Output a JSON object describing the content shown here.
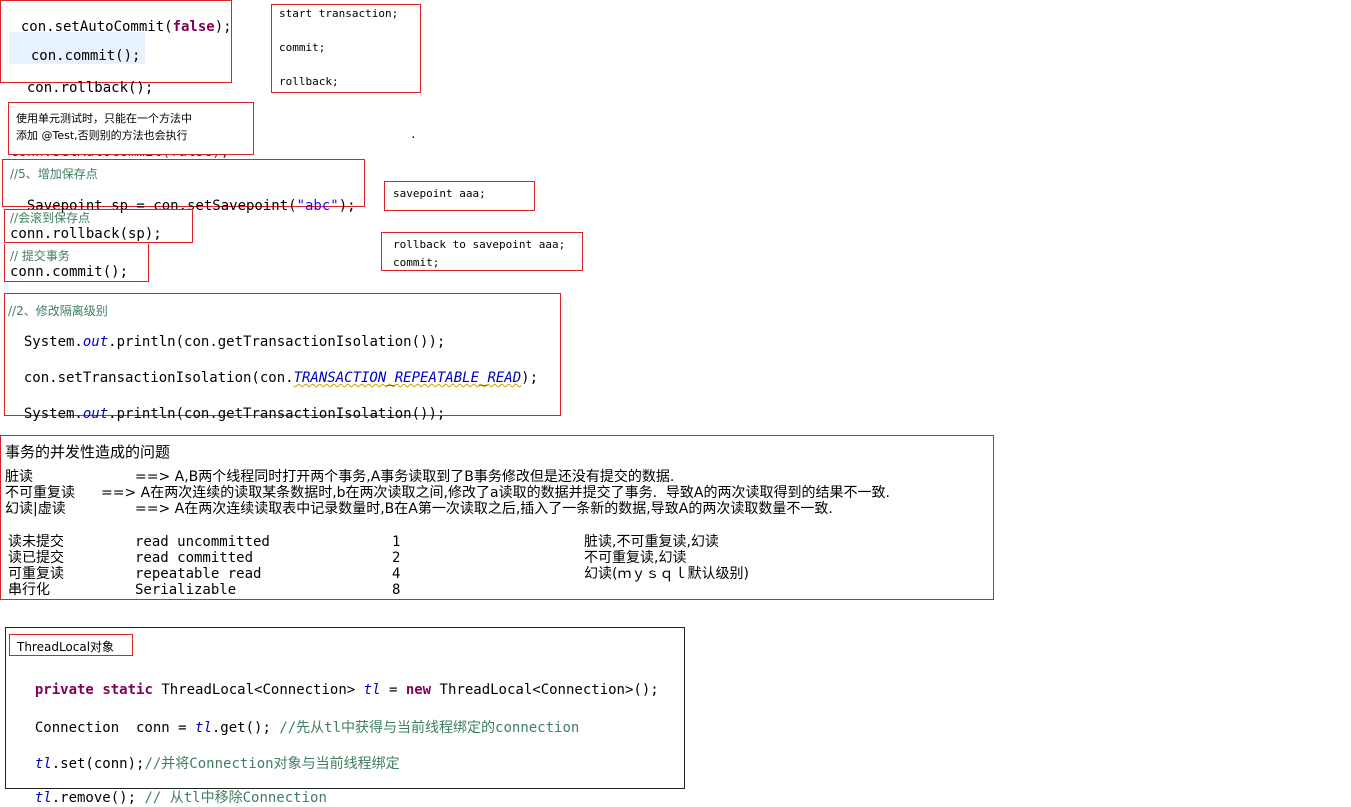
{
  "commit_block": {
    "set_autocommit_prefix": "con.setAutoCommit(",
    "false_kw": "false",
    "set_autocommit_suffix": ");",
    "commit": "con.commit();",
    "rollback": "con.rollback();"
  },
  "sql_block": {
    "start": "start transaction;",
    "commit": "commit;",
    "rollback": "rollback;"
  },
  "note": {
    "line1": "使用单元测试时，只能在一个方法中",
    "line2": "添加 @Test,否则别的方法也会执行",
    "dot": ".",
    "hidden_line": "conn.setAutoCommit(false);"
  },
  "savepoint_block": {
    "comment": "//5、增加保存点",
    "code_prefix": "Savepoint sp = con.setSavepoint(",
    "code_string": "\"abc\"",
    "code_suffix": ");"
  },
  "savepoint_sql": "savepoint aaa;",
  "rollback_block": {
    "comment": "//会滚到保存点",
    "code": "conn.rollback(sp);"
  },
  "commit_block2": {
    "comment": "// 提交事务",
    "code": "conn.commit();"
  },
  "rollback_sql": {
    "line1": "rollback to savepoint aaa;",
    "line2": "commit;"
  },
  "isolation_block": {
    "comment": "//2、修改隔离级别",
    "line1_prefix": "System.",
    "line1_out": "out",
    "line1_suffix": ".println(con.getTransactionIsolation());",
    "line2_prefix": "con.setTransactionIsolation(con.",
    "line2_const": "TRANSACTION_REPEATABLE_READ",
    "line2_suffix": ");",
    "line3_prefix": "System.",
    "line3_out": "out",
    "line3_suffix": ".println(con.getTransactionIsolation());"
  },
  "concurrency": {
    "title": "事务的并发性造成的问题",
    "problems": [
      {
        "name": "脏读",
        "desc": "==> A,B两个线程同时打开两个事务,A事务读取到了B事务修改但是还没有提交的数据."
      },
      {
        "name": "不可重复读",
        "desc": "==> A在两次连续的读取某条数据时,b在两次读取之间,修改了a读取的数据并提交了事务.  导致A的两次读取得到的结果不一致."
      },
      {
        "name": "幻读|虚读",
        "desc": "==> A在两次连续读取表中记录数量时,B在A第一次读取之后,插入了一条新的数据,导致A的两次读取数量不一致."
      }
    ],
    "levels": [
      {
        "cn": "读未提交",
        "en": "read uncommitted",
        "num": "1",
        "issues": "脏读,不可重复读,幻读"
      },
      {
        "cn": "读已提交",
        "en": "read committed",
        "num": "2",
        "issues": "不可重复读,幻读"
      },
      {
        "cn": "可重复读",
        "en": "repeatable read",
        "num": "4",
        "issues": "幻读(ｍｙｓｑｌ默认级别)"
      },
      {
        "cn": "串行化",
        "en": "Serializable",
        "num": "8",
        "issues": ""
      }
    ]
  },
  "threadlocal": {
    "title": "ThreadLocal对象",
    "decl_private": "private",
    "decl_static": "static",
    "decl_type": "ThreadLocal<Connection>",
    "decl_var": "tl",
    "decl_eq": "=",
    "decl_new": "new",
    "decl_rest": "ThreadLocal<Connection>();",
    "get_prefix": "Connection  conn = ",
    "get_var": "tl",
    "get_suffix": ".get(); ",
    "get_comment": "//先从tl中获得与当前线程绑定的connection",
    "set_var": "tl",
    "set_suffix": ".set(conn);",
    "set_comment": "//并将Connection对象与当前线程绑定",
    "remove_var": "tl",
    "remove_suffix": ".remove(); ",
    "remove_comment": "// 从tl中移除Connection"
  },
  "colors": {
    "border_red": "#d9222a",
    "keyword": "#7f0055",
    "field": "#0000c0",
    "string": "#2a00ff",
    "comment": "#3f7f5f"
  }
}
